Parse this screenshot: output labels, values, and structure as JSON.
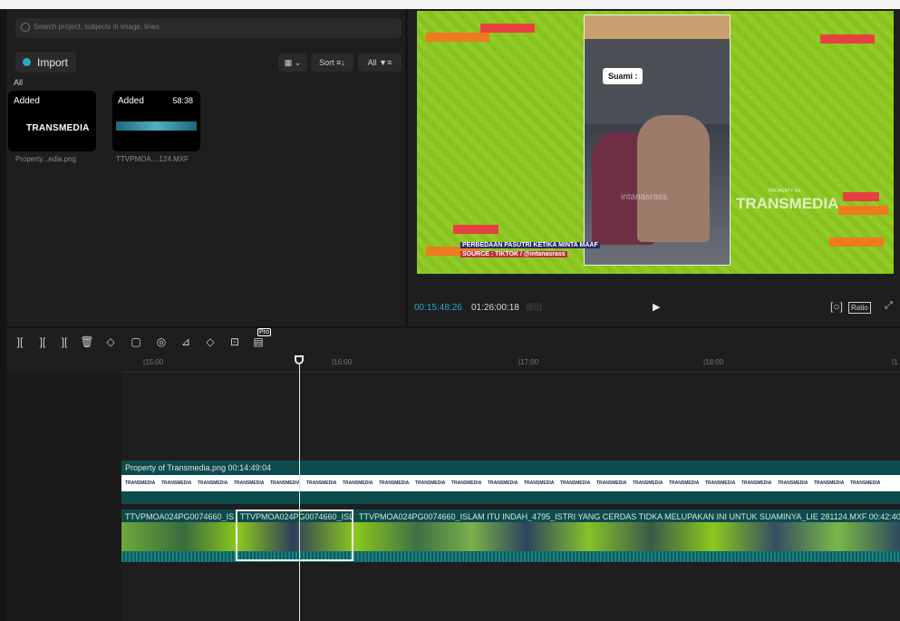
{
  "media": {
    "search_placeholder": "Search project, subjects in image, lines",
    "import_label": "Import",
    "sort_label": "Sort",
    "filter_label": "All",
    "section_label": "All",
    "items": [
      {
        "badge": "Added",
        "duration": "",
        "thumb_text": "TRANSMEDIA",
        "name": "Property...edia.png"
      },
      {
        "badge": "Added",
        "duration": "58:38",
        "thumb_text": "",
        "name": "TTVPMOA....124.MXF"
      }
    ]
  },
  "preview": {
    "overlay_label": "Suami :",
    "caption_line1": "PERBEDAAN PASUTRI KETIKA MINTA MAAF",
    "caption_line2": "SOURCE : TIKTOK / @intanasrass",
    "watermark_small": "PROPERTY OF",
    "watermark": "TRANSMEDIA",
    "handle": "intanasrass",
    "current_time": "00:15:48:26",
    "total_time": "01:26:00:18",
    "ratio_label": "Ratio",
    "colors": {
      "accent": "#2aa7c9",
      "bg": "#8cc81e"
    }
  },
  "toolbar": {
    "icons": [
      "split-icon",
      "split-left-icon",
      "split-right-icon",
      "delete-icon",
      "marker-icon",
      "freeze-icon",
      "speed-icon",
      "mirror-icon",
      "rotate-icon",
      "crop-icon",
      "pro-feature-icon"
    ],
    "pro_badge": "Pro"
  },
  "timeline": {
    "ticks": [
      "|15:00",
      "|16:00",
      "|17:00",
      "|18:00",
      "|1"
    ],
    "track_a_label": "Property of Transmedia.png  00:14:49:04",
    "track_a_thumb": "TRANSMEDIA",
    "track_b_labels": [
      "TTVPMOA024PG0074660_ISL",
      "TTVPMOA024PG0074660_ISL",
      "TTVPMOA024PG0074660_ISLAM ITU INDAH_4795_ISTRI YANG CERDAS TIDKA MELUPAKAN INI UNTUK SUAMINYA_LIE 281124.MXF  00:42:40:"
    ]
  }
}
